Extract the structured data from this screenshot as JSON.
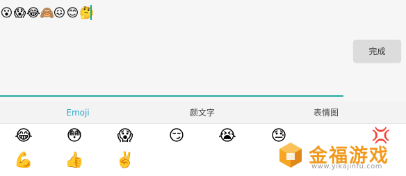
{
  "input": {
    "emojis": [
      "😮",
      "😱",
      "😂",
      "🙈",
      "😖",
      "😊",
      "🤔"
    ]
  },
  "done_button": {
    "label": "完成"
  },
  "tabs": [
    {
      "label": "Emoji",
      "active": true
    },
    {
      "label": "颜文字",
      "active": false
    },
    {
      "label": "表情图",
      "active": false
    }
  ],
  "emoji_grid": {
    "row1": [
      "😂",
      "😳",
      "😱",
      "😏",
      "😭",
      "😓",
      "💢"
    ],
    "row2": [
      "💪",
      "👍",
      "✌️"
    ]
  },
  "watermark": {
    "title": "金福游戏",
    "url": "www.yikajinfu.com"
  },
  "colors": {
    "accent": "#22a99c",
    "tab_active": "#2aa6c4",
    "watermark": "#f29a1f"
  }
}
